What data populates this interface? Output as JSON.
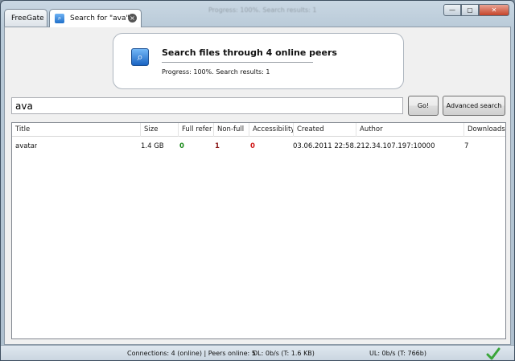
{
  "window": {
    "ghost_title": "Progress: 100%. Search results: 1"
  },
  "tabs": [
    {
      "label": "FreeGate"
    },
    {
      "label": "Search for \"ava\"",
      "close": "×"
    }
  ],
  "controls": {
    "minimize": "—",
    "maximize": "▢",
    "close": "✕"
  },
  "hero": {
    "title": "Search files through 4 online peers",
    "status": "Progress: 100%. Search results: 1"
  },
  "search": {
    "value": "ava",
    "go_label": "Go!",
    "advanced_label": "Advanced search"
  },
  "table": {
    "columns": [
      "Title",
      "Size",
      "Full refer",
      "Non-full",
      "Accessibility",
      "Created",
      "Author",
      "Downloads"
    ],
    "rows": [
      {
        "title": "avatar",
        "size": "1.4 GB",
        "full_ref": "0",
        "non_full": "1",
        "accessibility": "0",
        "created": "03.06.2011 22:58...",
        "author": "212.34.107.197:10000",
        "downloads": "7"
      }
    ]
  },
  "colors": {
    "full_ref": "#1a8a1a",
    "non_full": "#8b1a1a",
    "accessibility": "#d01818",
    "ok_check": "#3aa53a"
  },
  "status": {
    "connections": "Connections: 4 (online) | Peers online: 5",
    "download": "DL: 0b/s (T: 1.6 KB)",
    "upload": "UL: 0b/s (T: 766b)",
    "ok_icon": "checkmark-icon"
  }
}
